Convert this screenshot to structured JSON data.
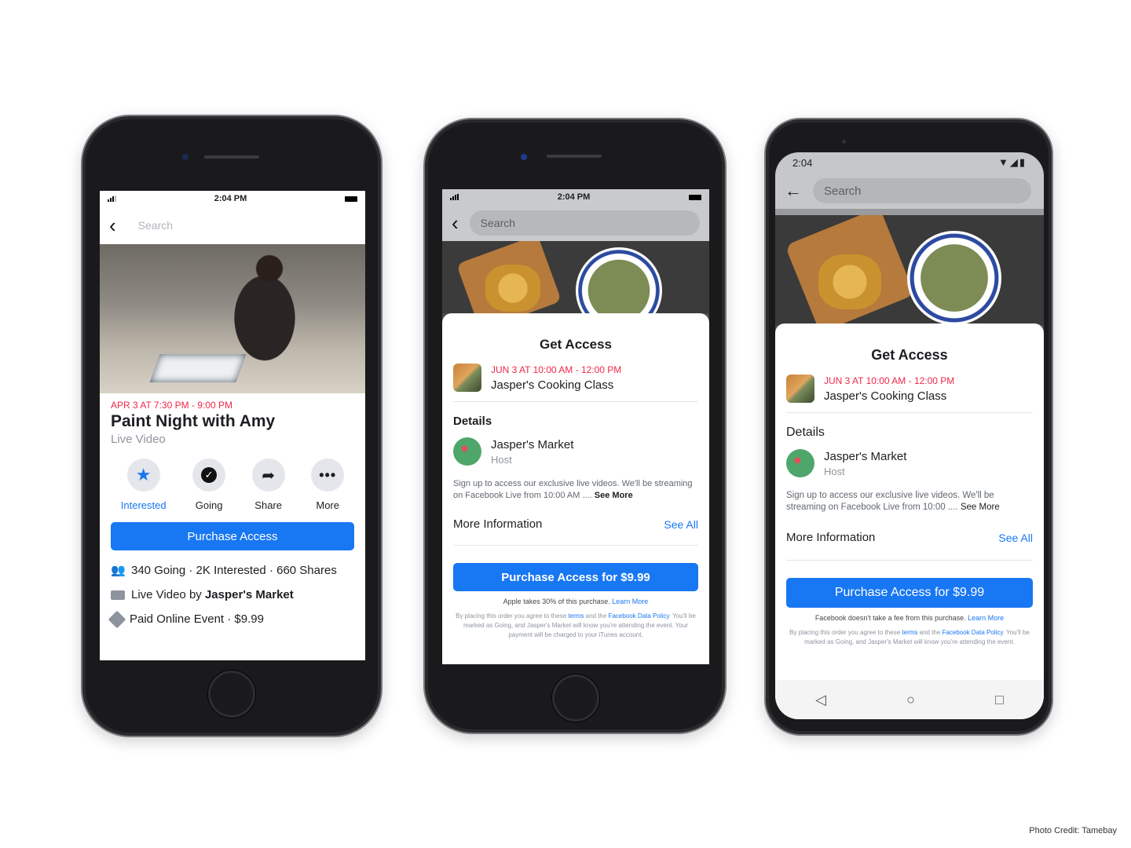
{
  "credit": "Photo Credit: Tamebay",
  "phone1": {
    "status_time": "2:04 PM",
    "search_placeholder": "Search",
    "event_date": "APR 3 AT 7:30 PM - 9:00 PM",
    "event_title": "Paint Night with Amy",
    "event_type": "Live Video",
    "actions": [
      {
        "label": "Interested",
        "icon": "star-icon"
      },
      {
        "label": "Going",
        "icon": "check-circle-icon"
      },
      {
        "label": "Share",
        "icon": "share-arrow-icon"
      },
      {
        "label": "More",
        "icon": "more-dots-icon"
      }
    ],
    "purchase_label": "Purchase Access",
    "stats": "340 Going · 2K Interested · 660 Shares",
    "live_by_prefix": "Live Video by ",
    "live_by_host": "Jasper's Market",
    "paid_event": "Paid Online Event · $9.99"
  },
  "phone2": {
    "status_time": "2:04 PM",
    "search_placeholder": "Search",
    "card_title": "Get Access",
    "event_date": "JUN 3 AT 10:00 AM - 12:00 PM",
    "event_name": "Jasper's Cooking Class",
    "details_heading": "Details",
    "host_name": "Jasper's Market",
    "host_role": "Host",
    "description": "Sign up to access our exclusive live videos. We'll be streaming on Facebook Live from 10:00 AM ....",
    "see_more": "See More",
    "more_info": "More Information",
    "see_all": "See All",
    "purchase_label": "Purchase Access for $9.99",
    "fee_note": "Apple takes 30% of this purchase.",
    "learn_more": "Learn More",
    "fine_print_1": "By placing this order you agree to these",
    "terms": "terms",
    "fine_print_2": "and the",
    "data_policy": "Facebook Data Policy",
    "fine_print_3": ". You'll be marked as Going, and Jasper's Market will know you're attending the event. Your payment will be charged to your iTunes account."
  },
  "phone3": {
    "status_time": "2:04",
    "search_placeholder": "Search",
    "card_title": "Get Access",
    "event_date": "JUN 3 AT 10:00 AM - 12:00 PM",
    "event_name": "Jasper's Cooking Class",
    "details_heading": "Details",
    "host_name": "Jasper's Market",
    "host_role": "Host",
    "description": "Sign up to access our exclusive live videos. We'll be streaming on Facebook Live from 10:00 ....",
    "see_more": "See More",
    "more_info": "More Information",
    "see_all": "See All",
    "purchase_label": "Purchase Access for $9.99",
    "fee_note": "Facebook doesn't take a fee from this purchase.",
    "learn_more": "Learn More",
    "fine_print_1": "By placing this order you agree to these",
    "terms": "terms",
    "fine_print_2": "and the",
    "data_policy": "Facebook Data Policy",
    "fine_print_3": ". You'll be marked as Going, and Jasper's Market will know you're attending the event."
  },
  "colors": {
    "accent": "#1877f2",
    "date_red": "#f02849"
  }
}
